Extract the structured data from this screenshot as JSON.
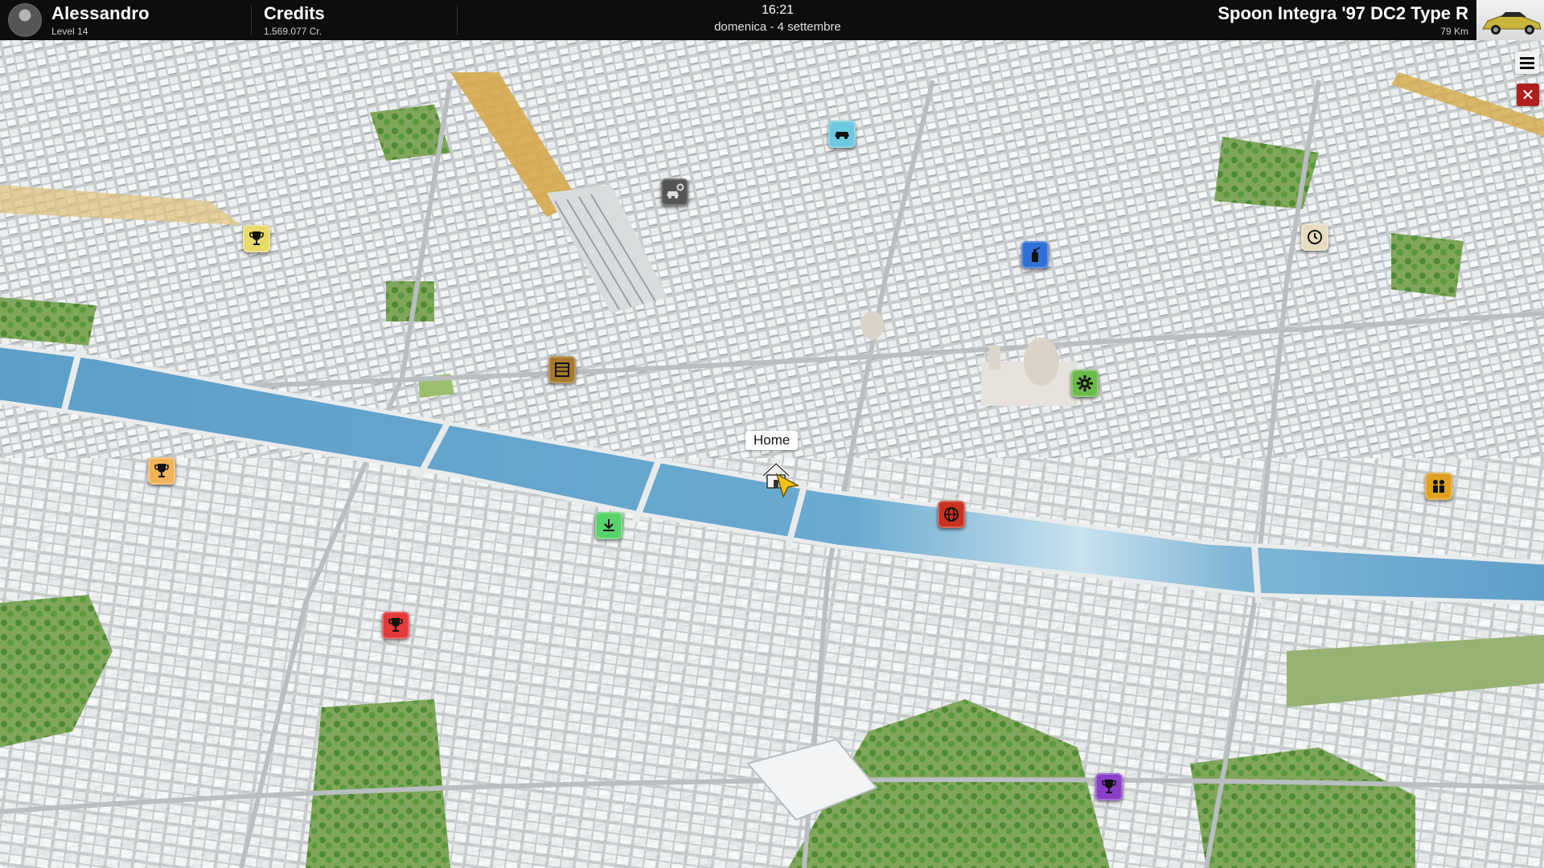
{
  "player": {
    "name": "Alessandro",
    "level": "Level 14"
  },
  "credits": {
    "title": "Credits",
    "value": "1.569.077 Cr."
  },
  "clock": {
    "time": "16:21",
    "date": "domenica - 4 settembre"
  },
  "car": {
    "name": "Spoon Integra '97 DC2 Type R",
    "distance": "79 Km"
  },
  "map": {
    "home_label": "Home",
    "markers": [
      {
        "kind": "car-dealer",
        "icon": "car-icon",
        "color": "#6ec9e0"
      },
      {
        "kind": "tuning-shop",
        "icon": "car-gear-icon",
        "color": "#444444"
      },
      {
        "kind": "championship-event",
        "icon": "trophy-icon",
        "color": "#e8d96b"
      },
      {
        "kind": "car-wash",
        "icon": "spray-icon",
        "color": "#2f6fd8"
      },
      {
        "kind": "time-challenge",
        "icon": "clock-icon",
        "color": "#e7dcc0"
      },
      {
        "kind": "archive",
        "icon": "crate-icon",
        "color": "#a57a2c"
      },
      {
        "kind": "mechanic",
        "icon": "gear-icon",
        "color": "#6abb4a"
      },
      {
        "kind": "championship-event",
        "icon": "trophy-icon",
        "color": "#f0b25a"
      },
      {
        "kind": "download",
        "icon": "download-icon",
        "color": "#58d26a"
      },
      {
        "kind": "online-event",
        "icon": "globe-icon",
        "color": "#c8321f"
      },
      {
        "kind": "meeting",
        "icon": "people-icon",
        "color": "#e0a020"
      },
      {
        "kind": "championship-event",
        "icon": "trophy-icon",
        "color": "#e43a3a"
      },
      {
        "kind": "championship-event",
        "icon": "trophy-icon",
        "color": "#8a3fc8"
      }
    ]
  },
  "controls": {
    "menu_icon": "hamburger-menu-icon",
    "close_icon": "close-icon"
  }
}
